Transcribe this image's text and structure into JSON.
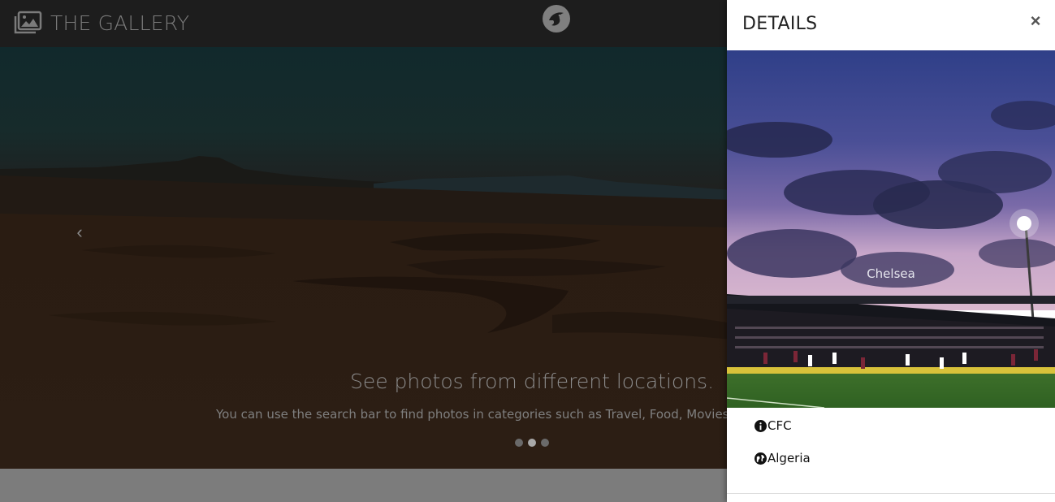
{
  "navbar": {
    "brand_text": "THE GALLERY",
    "brand_icon": "photo-library-icon",
    "center_logo_icon": "bird-logo-icon"
  },
  "carousel": {
    "prev_icon": "chevron-left-icon",
    "caption_title": "See photos from different locations.",
    "caption_subtitle": "You can use the search bar to find photos in categories such as Travel, Food, Movies, Places",
    "indicator_count": 3,
    "active_indicator": 2
  },
  "details_panel": {
    "title": "DETAILS",
    "close_label": "×",
    "photo_caption": "Chelsea",
    "info_label": "CFC",
    "info_icon": "info-circle-icon",
    "location_label": "Algeria",
    "location_icon": "globe-icon"
  },
  "colors": {
    "navbar_bg": "#1d1d1d",
    "panel_bg": "#ffffff",
    "muted_text": "#8c8c8c"
  }
}
